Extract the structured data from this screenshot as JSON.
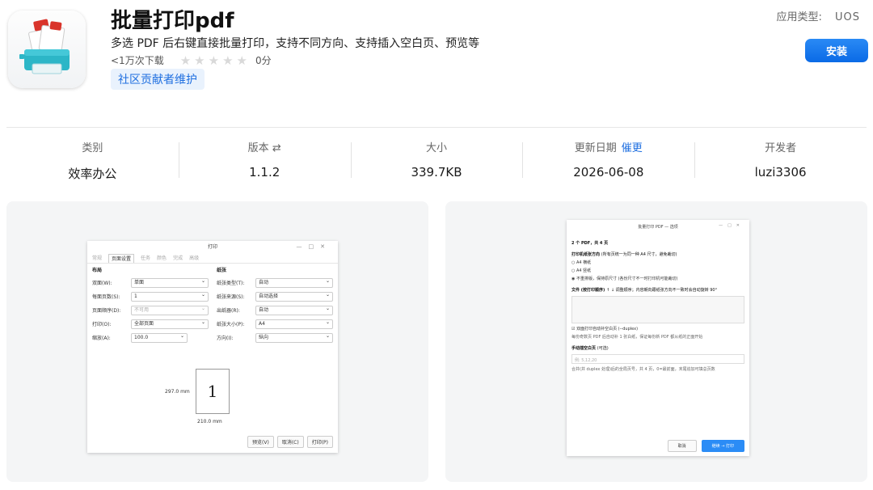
{
  "app": {
    "title": "批量打印pdf",
    "description": "多选 PDF 后右键直接批量打印，支持不同方向、支持插入空白页、预览等",
    "downloads": "<1万次下载",
    "rating_score": "0分",
    "rating_stars": 0,
    "community_tag": "社区贡献者维护",
    "type_label": "应用类型:",
    "type_value": "UOS",
    "install_label": "安装"
  },
  "info": {
    "category_label": "类别",
    "category_value": "效率办公",
    "version_label": "版本",
    "version_value": "1.1.2",
    "size_label": "大小",
    "size_value": "339.7KB",
    "updated_label": "更新日期",
    "updated_link": "催更",
    "updated_value": "2026-06-08",
    "developer_label": "开发者",
    "developer_value": "luzi3306"
  },
  "shot1": {
    "title": "打印",
    "tabs": [
      "常规",
      "页面设置",
      "任务",
      "颜色",
      "完成",
      "高级"
    ],
    "layout_title": "布局",
    "paper_title": "纸张",
    "left_fields": [
      {
        "label": "双面(W):",
        "value": "单面"
      },
      {
        "label": "每面页数(S):",
        "value": "1"
      },
      {
        "label": "页面顺序(D):",
        "value": "不可用"
      },
      {
        "label": "打印(O):",
        "value": "全部页面"
      },
      {
        "label": "缩放(A):",
        "value": "100.0"
      }
    ],
    "right_fields": [
      {
        "label": "纸张类型(T):",
        "value": "自动"
      },
      {
        "label": "纸张来源(S):",
        "value": "自动选择"
      },
      {
        "label": "出纸器(R):",
        "value": "自动"
      },
      {
        "label": "纸张大小(P):",
        "value": "A4"
      },
      {
        "label": "方向(I):",
        "value": "纵向"
      }
    ],
    "preview_number": "1",
    "height_label": "297.0 mm",
    "width_label": "210.0 mm",
    "buttons": [
      "预览(V)",
      "取消(C)",
      "打印(P)"
    ]
  },
  "shot2": {
    "title": "批量打印 PDF — 选项",
    "summary": "2 个 PDF，共 4 页",
    "orientation_title": "打印机纸张方向",
    "orientation_hint": "(所有页统一为同一种 A4 尺寸，避免裁切)",
    "options": [
      "A4 横纸",
      "A4 竖纸",
      "不重排版，保持原尺寸 (各份尺寸不一时打印机可能裁切)"
    ],
    "files_title": "文件 (按打印顺序)",
    "files_hint": "↑ ↓ 调整顺序；内容朝向跟纸张方向不一致时会自动旋转 90°",
    "duplex": "双面打印自动补空白页 (--duplex)",
    "duplex_hint": "每份奇数页 PDF 后自动补 1 张白纸，保证每份新 PDF 都从纸的正面开始",
    "blank_title": "手动插空白页",
    "blank_optional": "(可选)",
    "blank_placeholder": "例: 5,12,20",
    "blank_hint": "合并(并 duplex 处理)后的全局页号，共 4 页，0=最前面，末尾追加可填总页数",
    "cancel": "取消",
    "continue": "继续 → 打印"
  }
}
